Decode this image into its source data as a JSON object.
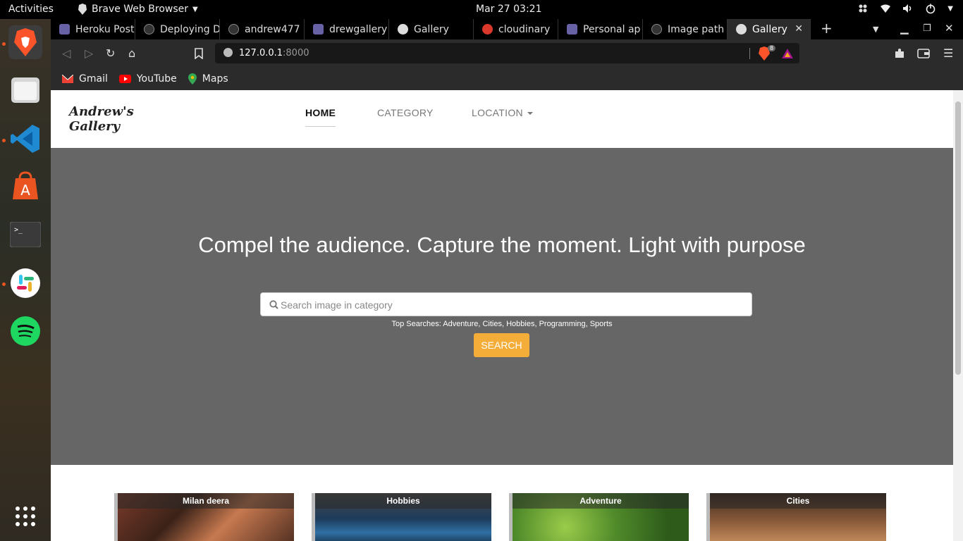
{
  "system": {
    "activities": "Activities",
    "app_name": "Brave Web Browser",
    "clock": "Mar 27  03:21",
    "tray_icons": [
      "slack-tray-icon",
      "wifi-icon",
      "volume-icon",
      "power-icon"
    ]
  },
  "dock": {
    "apps": [
      "Brave",
      "Files",
      "Visual Studio Code",
      "Ubuntu Software",
      "Terminal",
      "Slack",
      "Spotify",
      "Show Applications"
    ]
  },
  "tabs": [
    {
      "title": "Heroku Post",
      "icon": "heroku-icon",
      "color": "#6762a6"
    },
    {
      "title": "Deploying D",
      "icon": "github-icon",
      "color": "#333333"
    },
    {
      "title": "andrew477",
      "icon": "github-icon",
      "color": "#333333"
    },
    {
      "title": "drewgallery",
      "icon": "heroku-icon",
      "color": "#6762a6"
    },
    {
      "title": "Gallery",
      "icon": "globe-icon",
      "color": "#dddddd"
    },
    {
      "title": "cloudinary",
      "icon": "cloudinary-icon",
      "color": "#d9382b"
    },
    {
      "title": "Personal ap",
      "icon": "heroku-icon",
      "color": "#6762a6"
    },
    {
      "title": "Image path",
      "icon": "github-icon",
      "color": "#333333"
    },
    {
      "title": "Gallery",
      "icon": "globe-icon",
      "color": "#dddddd",
      "active": true
    }
  ],
  "toolbar": {
    "url_host": "127.0.0.1",
    "url_port": ":8000",
    "shields_count": "8"
  },
  "bookmarks": [
    {
      "label": "Gmail",
      "icon": "gmail-icon"
    },
    {
      "label": "YouTube",
      "icon": "youtube-icon"
    },
    {
      "label": "Maps",
      "icon": "maps-icon"
    }
  ],
  "page": {
    "brand": "Andrew's Gallery",
    "brand_line1": "Andrew's",
    "brand_line2": "Gallery",
    "nav": {
      "home": "HOME",
      "category": "CATEGORY",
      "location": "LOCATION"
    },
    "hero": {
      "headline": "Compel the audience. Capture the moment. Light with purpose",
      "search_placeholder": "Search image in category",
      "top_searches": "Top Searches: Adventure, Cities, Hobbies, Programming, Sports",
      "search_button": "SEARCH"
    },
    "cards": [
      {
        "label": "Milan deera"
      },
      {
        "label": "Hobbies"
      },
      {
        "label": "Adventure"
      },
      {
        "label": "Cities"
      }
    ],
    "colors": {
      "hero_bg": "#666666",
      "search_button": "#f4ad38",
      "brave_orange": "#fb542b"
    }
  }
}
